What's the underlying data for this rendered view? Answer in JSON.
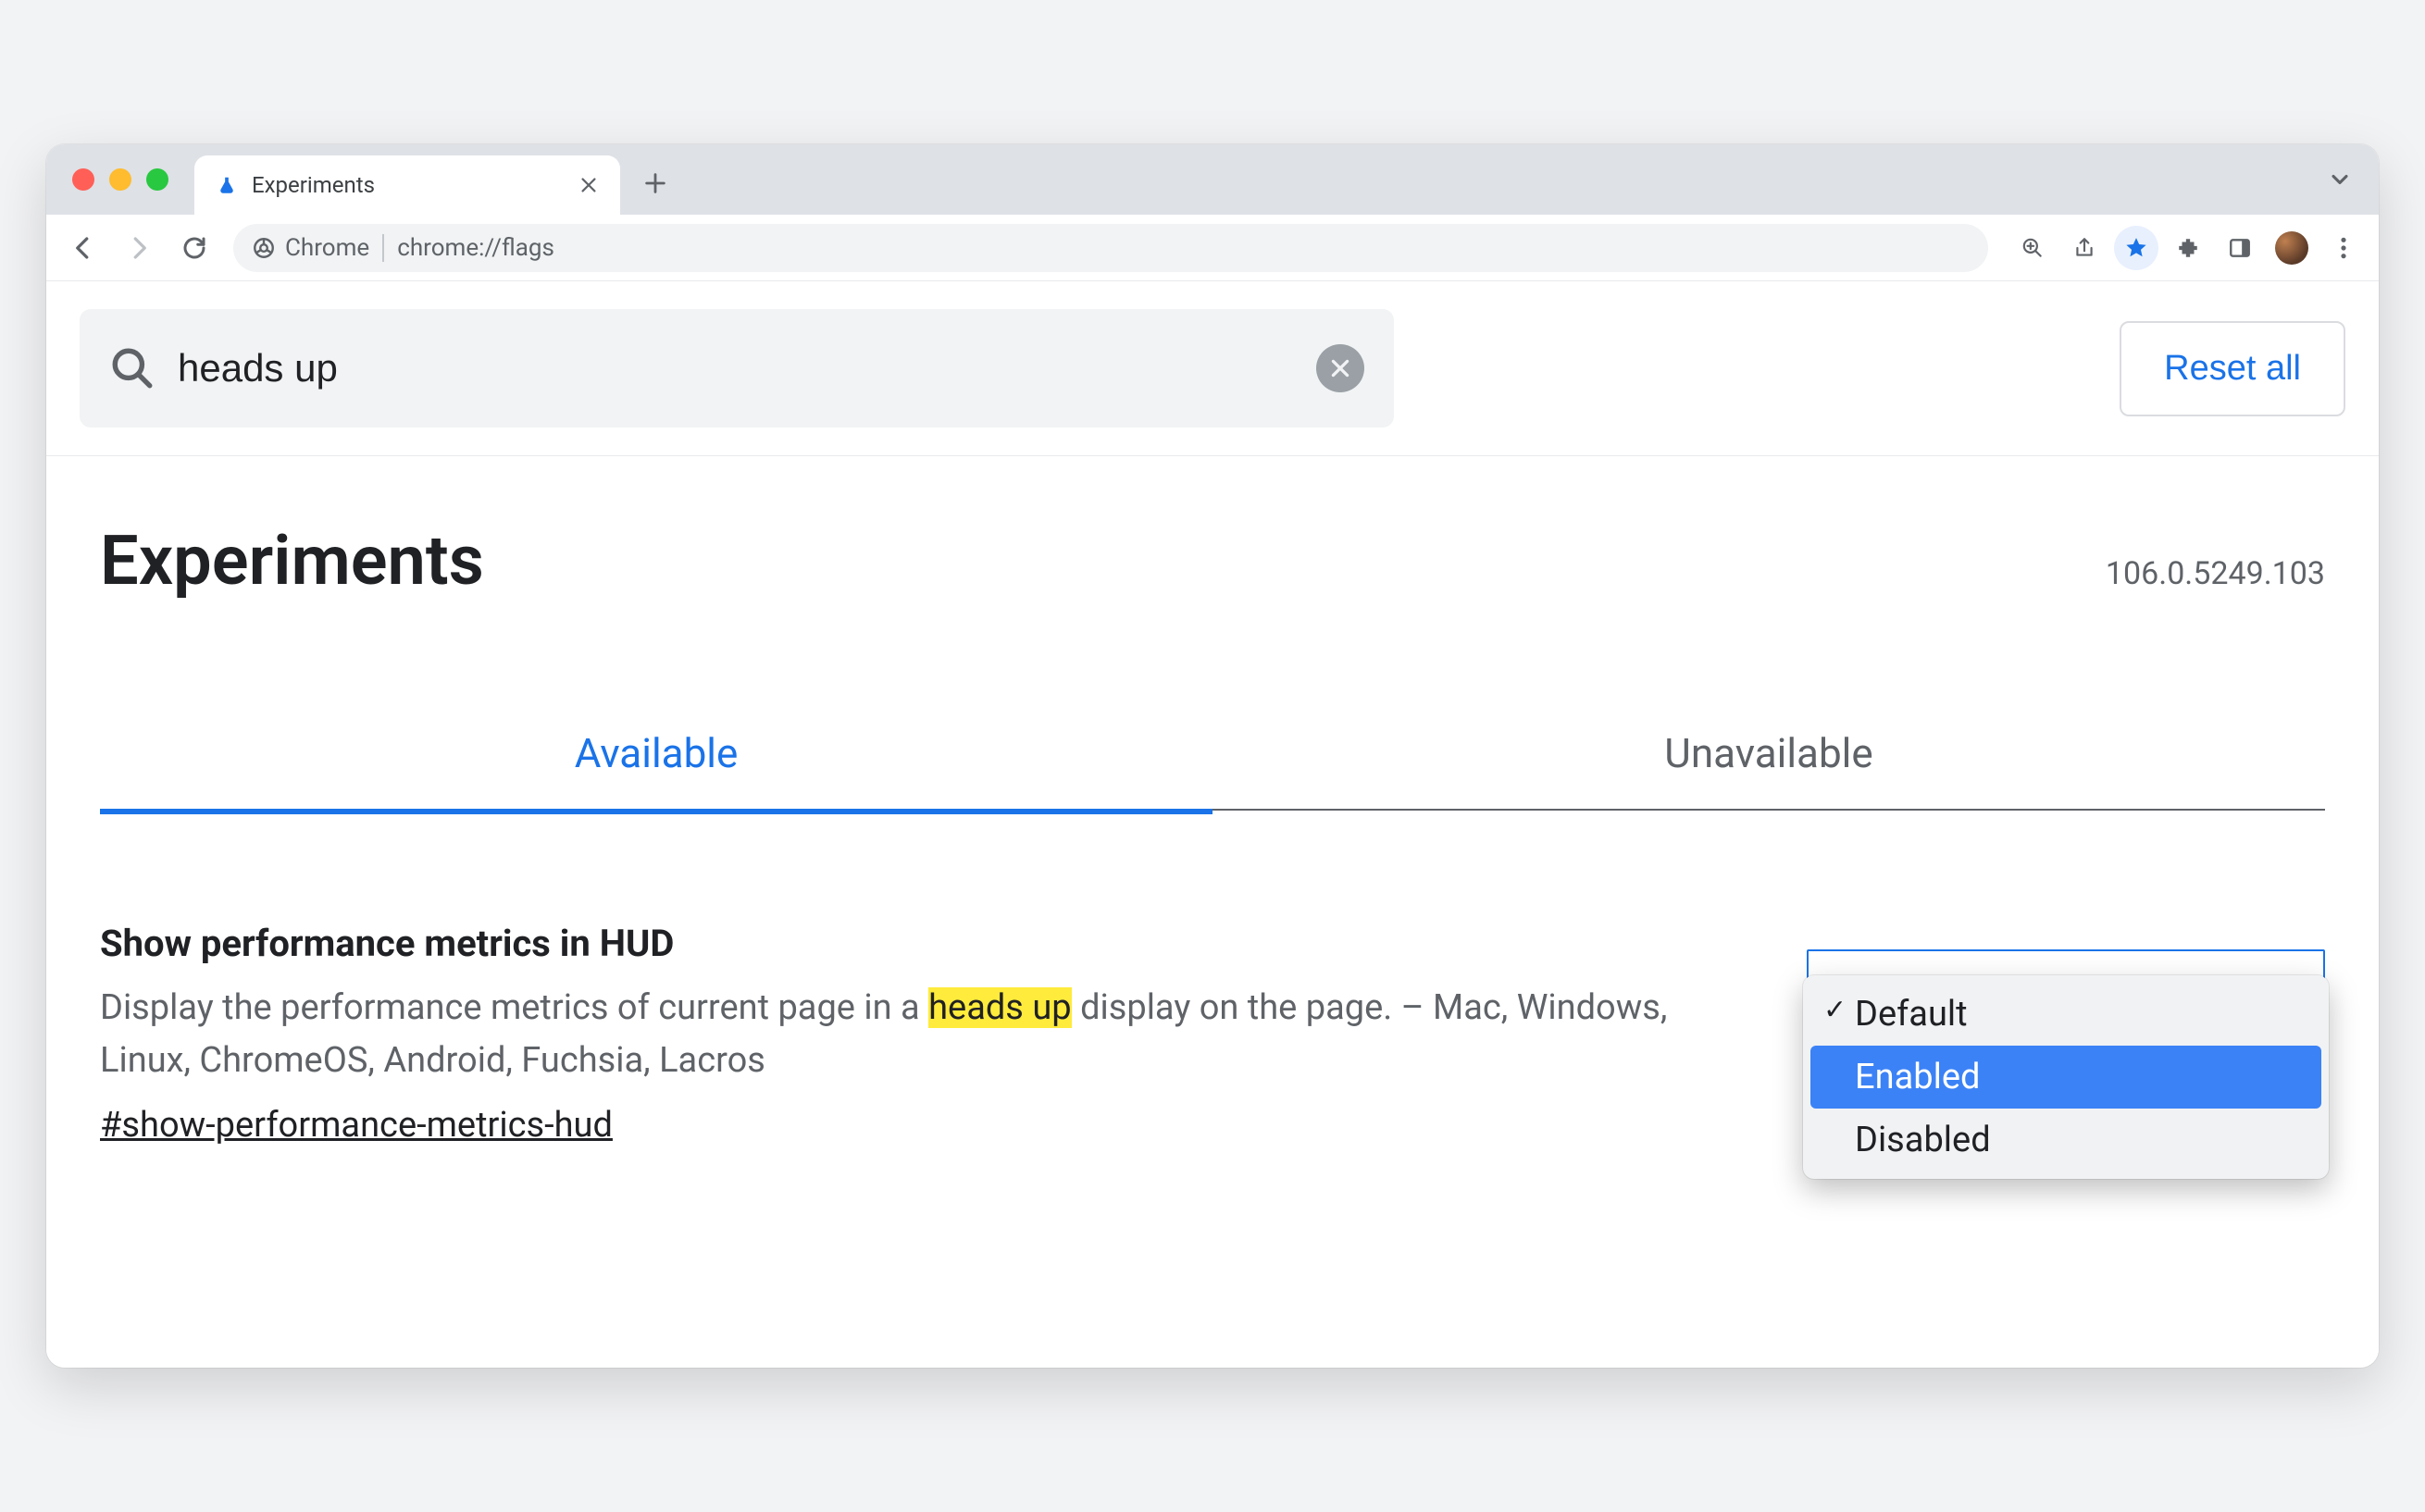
{
  "browser": {
    "tab_title": "Experiments",
    "omnibox_chip": "Chrome",
    "url": "chrome://flags"
  },
  "search": {
    "value": "heads up",
    "reset_label": "Reset all"
  },
  "header": {
    "title": "Experiments",
    "version": "106.0.5249.103"
  },
  "tabs": {
    "available": "Available",
    "unavailable": "Unavailable"
  },
  "experiment": {
    "title": "Show performance metrics in HUD",
    "desc_pre": "Display the performance metrics of current page in a ",
    "desc_hl": "heads up",
    "desc_post": " display on the page. – Mac, Windows, Linux, ChromeOS, Android, Fuchsia, Lacros",
    "hash": "#show-performance-metrics-hud",
    "options": {
      "default": "Default",
      "enabled": "Enabled",
      "disabled": "Disabled"
    }
  }
}
